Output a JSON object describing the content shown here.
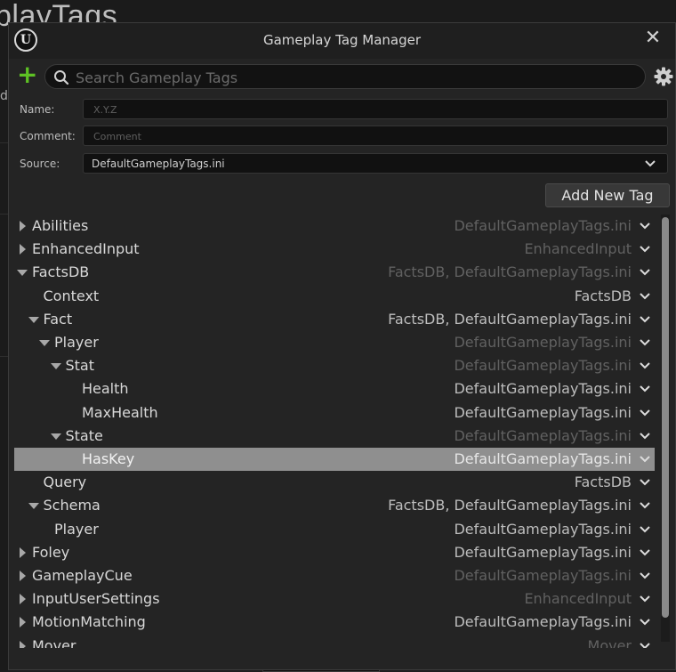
{
  "background": {
    "title_fragment": "playTags",
    "letter": "d"
  },
  "dialog": {
    "title": "Gameplay Tag Manager",
    "close_glyph": "✕",
    "logo_glyph": "U",
    "add_glyph": "+",
    "search": {
      "placeholder": "Search Gameplay Tags",
      "value": ""
    },
    "form": {
      "name_label": "Name:",
      "name_placeholder": "X.Y.Z",
      "comment_label": "Comment:",
      "comment_placeholder": "Comment",
      "source_label": "Source:",
      "source_value": "DefaultGameplayTags.ini"
    },
    "add_tag_label": "Add New Tag",
    "colors": {
      "accent_green": "#5ec224",
      "selected_row": "#8f8f8f"
    }
  },
  "tree": {
    "rows": [
      {
        "name": "Abilities",
        "source": "DefaultGameplayTags.ini",
        "depth": 0,
        "expander": "collapsed",
        "dim": true,
        "selected": false
      },
      {
        "name": "EnhancedInput",
        "source": "EnhancedInput",
        "depth": 0,
        "expander": "collapsed",
        "dim": true,
        "selected": false
      },
      {
        "name": "FactsDB",
        "source": "FactsDB, DefaultGameplayTags.ini",
        "depth": 0,
        "expander": "expanded",
        "dim": true,
        "selected": false
      },
      {
        "name": "Context",
        "source": "FactsDB",
        "depth": 1,
        "expander": "none",
        "dim": false,
        "selected": false
      },
      {
        "name": "Fact",
        "source": "FactsDB, DefaultGameplayTags.ini",
        "depth": 1,
        "expander": "expanded",
        "dim": false,
        "selected": false
      },
      {
        "name": "Player",
        "source": "DefaultGameplayTags.ini",
        "depth": 2,
        "expander": "expanded",
        "dim": true,
        "selected": false
      },
      {
        "name": "Stat",
        "source": "DefaultGameplayTags.ini",
        "depth": 3,
        "expander": "expanded",
        "dim": true,
        "selected": false
      },
      {
        "name": "Health",
        "source": "DefaultGameplayTags.ini",
        "depth": 4,
        "expander": "none",
        "dim": false,
        "selected": false
      },
      {
        "name": "MaxHealth",
        "source": "DefaultGameplayTags.ini",
        "depth": 4,
        "expander": "none",
        "dim": false,
        "selected": false
      },
      {
        "name": "State",
        "source": "DefaultGameplayTags.ini",
        "depth": 3,
        "expander": "expanded",
        "dim": true,
        "selected": false
      },
      {
        "name": "HasKey",
        "source": "DefaultGameplayTags.ini",
        "depth": 4,
        "expander": "none",
        "dim": false,
        "selected": true
      },
      {
        "name": "Query",
        "source": "FactsDB",
        "depth": 1,
        "expander": "none",
        "dim": false,
        "selected": false
      },
      {
        "name": "Schema",
        "source": "FactsDB, DefaultGameplayTags.ini",
        "depth": 1,
        "expander": "expanded",
        "dim": false,
        "selected": false
      },
      {
        "name": "Player",
        "source": "DefaultGameplayTags.ini",
        "depth": 2,
        "expander": "none",
        "dim": false,
        "selected": false
      },
      {
        "name": "Foley",
        "source": "DefaultGameplayTags.ini",
        "depth": 0,
        "expander": "collapsed",
        "dim": false,
        "selected": false
      },
      {
        "name": "GameplayCue",
        "source": "DefaultGameplayTags.ini",
        "depth": 0,
        "expander": "collapsed",
        "dim": true,
        "selected": false
      },
      {
        "name": "InputUserSettings",
        "source": "EnhancedInput",
        "depth": 0,
        "expander": "collapsed",
        "dim": true,
        "selected": false
      },
      {
        "name": "MotionMatching",
        "source": "DefaultGameplayTags.ini",
        "depth": 0,
        "expander": "collapsed",
        "dim": false,
        "selected": false
      },
      {
        "name": "Mover",
        "source": "Mover",
        "depth": 0,
        "expander": "collapsed",
        "dim": true,
        "selected": false
      }
    ]
  }
}
